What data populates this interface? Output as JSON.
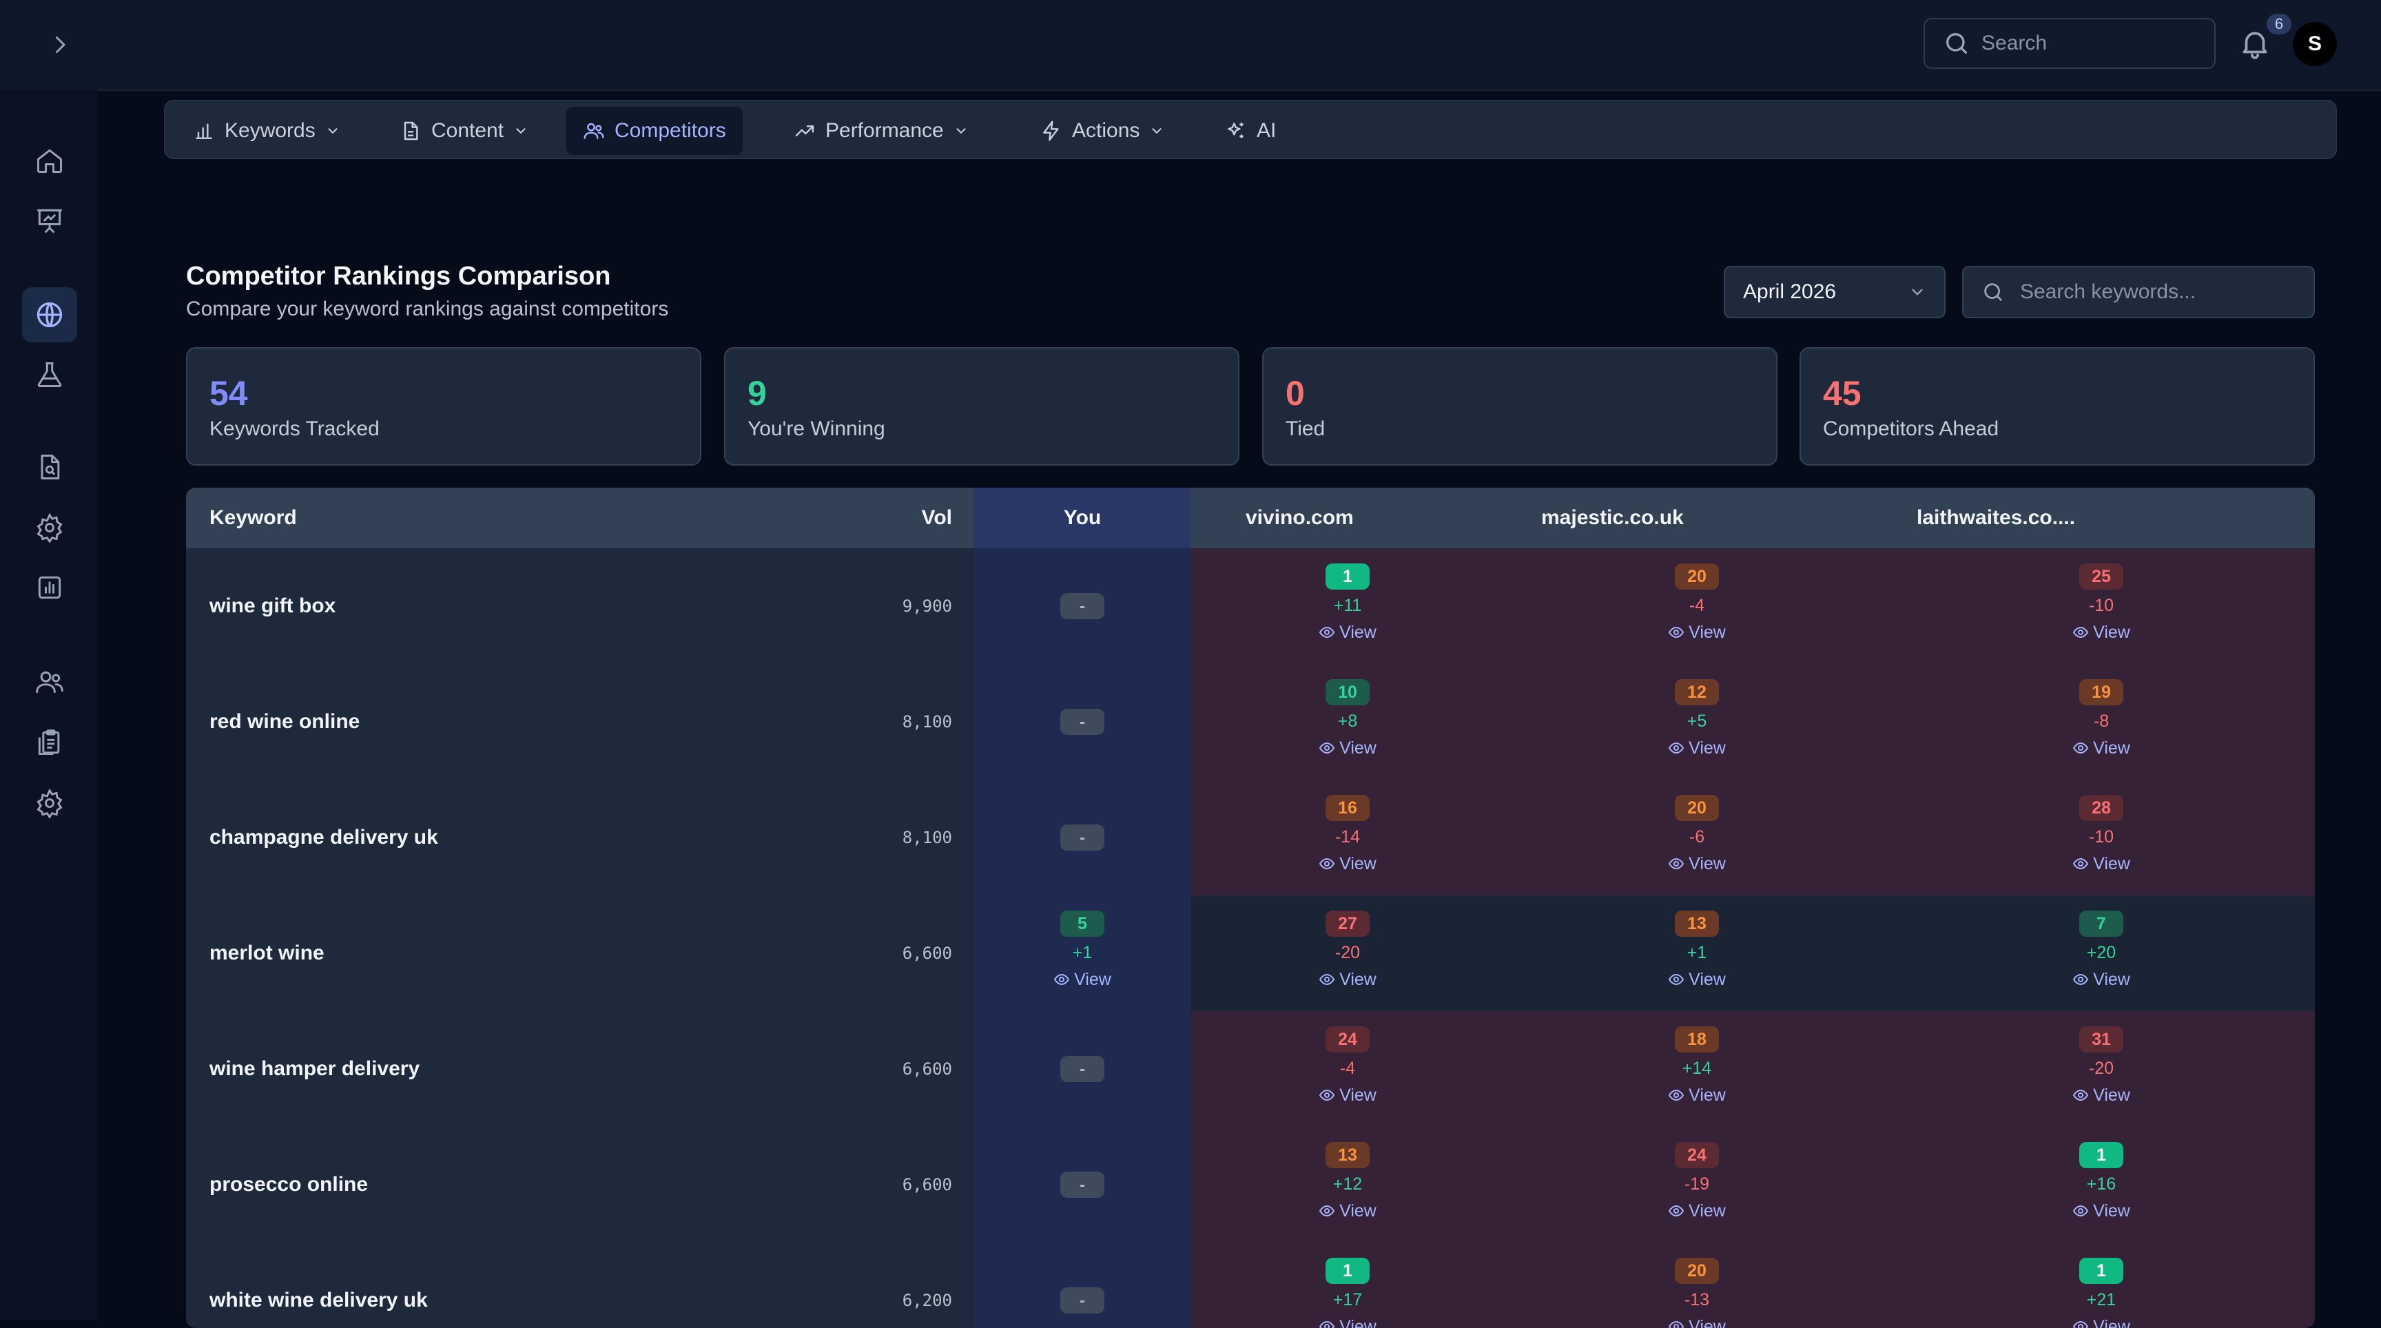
{
  "topbar": {
    "search_placeholder": "Search",
    "notification_count": "6",
    "avatar_initial": "S"
  },
  "sidebar": {
    "items": [
      {
        "icon": "home-icon"
      },
      {
        "icon": "presentation-icon"
      },
      {
        "icon": "globe-icon",
        "active": true
      },
      {
        "icon": "flask-icon"
      },
      {
        "icon": "file-search-icon"
      },
      {
        "icon": "gear-icon"
      },
      {
        "icon": "bar-chart-icon"
      },
      {
        "icon": "users-icon"
      },
      {
        "icon": "clipboard-icon"
      },
      {
        "icon": "settings-icon"
      }
    ]
  },
  "nav": {
    "tabs": [
      {
        "label": "Keywords",
        "icon": "bar-chart-icon",
        "dropdown": true
      },
      {
        "label": "Content",
        "icon": "file-icon",
        "dropdown": true
      },
      {
        "label": "Competitors",
        "icon": "users-icon",
        "dropdown": false,
        "active": true
      },
      {
        "label": "Performance",
        "icon": "trending-up-icon",
        "dropdown": true
      },
      {
        "label": "Actions",
        "icon": "lightning-icon",
        "dropdown": true
      },
      {
        "label": "AI",
        "icon": "sparkles-icon",
        "dropdown": false
      }
    ]
  },
  "header": {
    "title": "Competitor Rankings Comparison",
    "subtitle": "Compare your keyword rankings against competitors",
    "month": "April 2026",
    "search_placeholder": "Search keywords..."
  },
  "stats": [
    {
      "value": "54",
      "label": "Keywords Tracked",
      "color": "#818cf8"
    },
    {
      "value": "9",
      "label": "You're Winning",
      "color": "#34d399"
    },
    {
      "value": "0",
      "label": "Tied",
      "color": "#f87171"
    },
    {
      "value": "45",
      "label": "Competitors Ahead",
      "color": "#f87171"
    }
  ],
  "table": {
    "headers": {
      "keyword": "Keyword",
      "vol": "Vol",
      "you": "You",
      "c1": "vivino.com",
      "c2": "majestic.co.uk",
      "c3": "laithwaites.co...."
    },
    "view_label": "View",
    "empty_rank": "-",
    "rows": [
      {
        "keyword": "wine gift box",
        "vol": "9,900",
        "you": null,
        "bg": "red",
        "c": [
          {
            "rank": "1",
            "delta": "+11",
            "tone": "top",
            "sign": "pos"
          },
          {
            "rank": "20",
            "delta": "-4",
            "tone": "mid",
            "sign": "neg"
          },
          {
            "rank": "25",
            "delta": "-10",
            "tone": "bad",
            "sign": "neg"
          }
        ]
      },
      {
        "keyword": "red wine online",
        "vol": "8,100",
        "you": null,
        "bg": "red",
        "c": [
          {
            "rank": "10",
            "delta": "+8",
            "tone": "good",
            "sign": "pos"
          },
          {
            "rank": "12",
            "delta": "+5",
            "tone": "mid",
            "sign": "pos"
          },
          {
            "rank": "19",
            "delta": "-8",
            "tone": "mid",
            "sign": "neg"
          }
        ]
      },
      {
        "keyword": "champagne delivery uk",
        "vol": "8,100",
        "you": null,
        "bg": "red",
        "c": [
          {
            "rank": "16",
            "delta": "-14",
            "tone": "mid",
            "sign": "neg"
          },
          {
            "rank": "20",
            "delta": "-6",
            "tone": "mid",
            "sign": "neg"
          },
          {
            "rank": "28",
            "delta": "-10",
            "tone": "bad",
            "sign": "neg"
          }
        ]
      },
      {
        "keyword": "merlot wine",
        "vol": "6,600",
        "you": {
          "rank": "5",
          "delta": "+1",
          "tone": "good",
          "sign": "pos"
        },
        "bg": "dark",
        "c": [
          {
            "rank": "27",
            "delta": "-20",
            "tone": "bad",
            "sign": "neg"
          },
          {
            "rank": "13",
            "delta": "+1",
            "tone": "mid",
            "sign": "pos"
          },
          {
            "rank": "7",
            "delta": "+20",
            "tone": "good",
            "sign": "pos"
          }
        ]
      },
      {
        "keyword": "wine hamper delivery",
        "vol": "6,600",
        "you": null,
        "bg": "red",
        "c": [
          {
            "rank": "24",
            "delta": "-4",
            "tone": "bad",
            "sign": "neg"
          },
          {
            "rank": "18",
            "delta": "+14",
            "tone": "mid",
            "sign": "pos"
          },
          {
            "rank": "31",
            "delta": "-20",
            "tone": "bad",
            "sign": "neg"
          }
        ]
      },
      {
        "keyword": "prosecco online",
        "vol": "6,600",
        "you": null,
        "bg": "red",
        "c": [
          {
            "rank": "13",
            "delta": "+12",
            "tone": "mid",
            "sign": "pos"
          },
          {
            "rank": "24",
            "delta": "-19",
            "tone": "bad",
            "sign": "neg"
          },
          {
            "rank": "1",
            "delta": "+16",
            "tone": "top",
            "sign": "pos"
          }
        ]
      },
      {
        "keyword": "white wine delivery uk",
        "vol": "6,200",
        "you": null,
        "bg": "red",
        "c": [
          {
            "rank": "1",
            "delta": "+17",
            "tone": "top",
            "sign": "pos"
          },
          {
            "rank": "20",
            "delta": "-13",
            "tone": "mid",
            "sign": "neg"
          },
          {
            "rank": "1",
            "delta": "+21",
            "tone": "top",
            "sign": "pos"
          }
        ]
      }
    ]
  }
}
